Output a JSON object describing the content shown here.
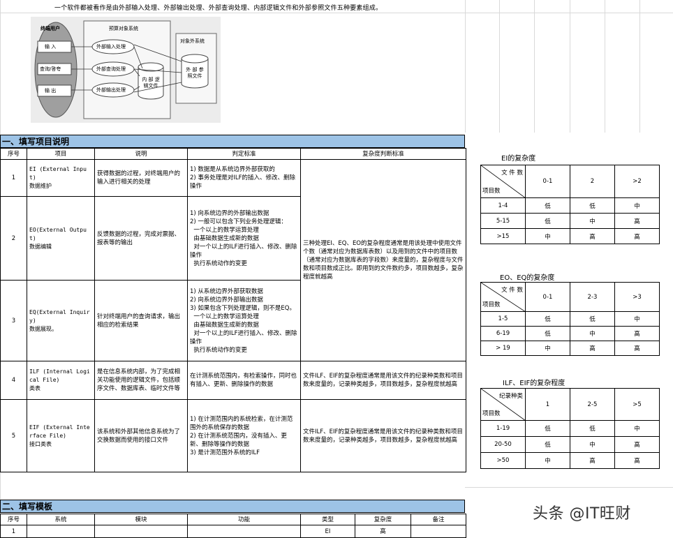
{
  "intro": "一个软件都被看作是由外部输入处理、外部输出处理、外部查询处理、内部逻辑文件和外部参照文件五种要素组成。",
  "diagram": {
    "end_user": "终端用户",
    "input": "输 入",
    "query": "查询/答夸",
    "output": "输 出",
    "system": "预算对象系统",
    "ext_input_proc": "外部输入处理",
    "ext_query_proc": "外部查询处理",
    "ext_output_proc": "外部输出处理",
    "internal_file": "内 部 逻辑文件",
    "ext_system": "对象外系统",
    "ext_file": "外 部 参照文件"
  },
  "section1": {
    "title": "一、填写项目说明",
    "headers": [
      "序号",
      "项目",
      "说明",
      "判定标准",
      "复杂度判断标准"
    ],
    "rows": [
      {
        "no": "1",
        "item": "EI (External Input)\n数据维护",
        "desc": "获得数据的过程，对终端用户的输入进行相关的处理",
        "criteria": "1) 数据是从系统边界外部获取的\n2) 事务处理是对ILF的插入、修改、删除操作"
      },
      {
        "no": "2",
        "item": "EO(External Output)\n数据编辑",
        "desc": "反馈数据的过程，完成对票据、报表等的输出",
        "criteria": "1) 向系统边界的外部输出数据\n2) 一般可以包含下列业务处理逻辑：\n  一个以上的数学运算处理\n  由基础数据生成新的数据\n  对一个以上的ILF进行插入、修改、删除操作\n  执行系统动作的变更"
      },
      {
        "no": "3",
        "item": "EQ(External Inquiry)\n数据展现。",
        "desc": "针对终端用户的查询请求，输出相应的检索结果",
        "criteria": "1) 从系统边界外部获取数据\n2) 向系统边界外部输出数据\n3) 如果包含下列处理逻辑，则不是EQ。\n  一个以上的数学运算处理\n  由基础数据生成新的数据\n  对一个以上的ILF进行插入、修改、删除操作\n  执行系统动作的变更"
      },
      {
        "no": "4",
        "item": "ILF (Internal Logical File)\n类表",
        "desc": "是在信息系统内部，为了完成相关功能使用的逻辑文件，包括顺序文件、数据库表、临时文件等",
        "criteria": "在计测系统范围内，有检索操作，同时也有插入、更新、删除操作的数据",
        "complexity": "文件ILF、EIF的复杂程度通常是用该文件的纪录种类数和项目数来度量的，记录种类越多，项目数越多，复杂程度就越高"
      },
      {
        "no": "5",
        "item": "EIF (External Interface File)\n接口类表",
        "desc": "该系统和外部其他信息系统为了交换数据而使用的接口文件",
        "criteria": "1) 在计测范围内的系统检索，在计测范围外的系统保存的数据\n2) 在计测系统范围内，没有插入、更新、删除等操作的数据\n3) 是计测范围外系统的ILF",
        "complexity": "文件ILF、EIF的复杂程度通常是用该文件的纪录种类数和项目数来度量的，记录种类越多，项目数越多，复杂程度就越高"
      }
    ],
    "complexity_merged": "三种处理EI、EQ、EO的复杂程度通常是用该处理中使用文件个数（通常对应为数据库表数）以及用到的文件中的项目数（通常对应为数据库表的字段数）来度量的，复杂程度与文件数和项目数成正比。即用到的文件数约多，项目数越多，复杂程度就越高"
  },
  "section2": {
    "title": "二、填写模板",
    "headers": [
      "序号",
      "系统",
      "模块",
      "功能",
      "类型",
      "复杂度",
      "备注"
    ],
    "row1": {
      "no": "1",
      "type": "EI",
      "complexity": "高"
    }
  },
  "ei_table": {
    "title": "EI的复杂度",
    "diag_top": "文 件 数",
    "diag_bottom": "项目数",
    "cols": [
      "0-1",
      "2",
      ">2"
    ],
    "rows": [
      {
        "label": "1-4",
        "cells": [
          "低",
          "低",
          "中"
        ]
      },
      {
        "label": "5-15",
        "cells": [
          "低",
          "中",
          "高"
        ]
      },
      {
        "label": ">15",
        "cells": [
          "中",
          "高",
          "高"
        ]
      }
    ]
  },
  "eo_table": {
    "title": "EO、EQ的复杂度",
    "diag_top": "文 件 数",
    "diag_bottom": "项目数",
    "cols": [
      "0-1",
      "2-3",
      ">3"
    ],
    "rows": [
      {
        "label": "1-5",
        "cells": [
          "低",
          "低",
          "中"
        ]
      },
      {
        "label": "6-19",
        "cells": [
          "低",
          "中",
          "高"
        ]
      },
      {
        "label": "> 19",
        "cells": [
          "中",
          "高",
          "高"
        ]
      }
    ]
  },
  "ilf_table": {
    "title": "ILF、EIF的复杂程度",
    "diag_top": "纪录种类",
    "diag_bottom": "项目数",
    "cols": [
      "1",
      "2-5",
      ">5"
    ],
    "rows": [
      {
        "label": "1-19",
        "cells": [
          "低",
          "低",
          "中"
        ]
      },
      {
        "label": "20-50",
        "cells": [
          "低",
          "中",
          "高"
        ]
      },
      {
        "label": ">50",
        "cells": [
          "中",
          "高",
          "高"
        ]
      }
    ]
  },
  "watermark": "头条 @IT旺财"
}
